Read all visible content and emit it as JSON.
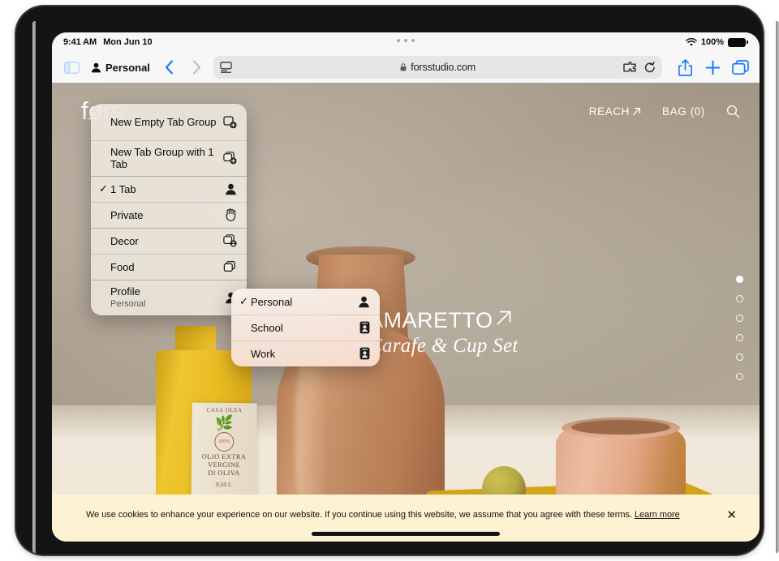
{
  "statusbar": {
    "time": "9:41 AM",
    "date": "Mon Jun 10",
    "wifi_icon": "wifi-icon",
    "battery_percent": "100%",
    "multitask_icon": "multitasking-dots-icon"
  },
  "toolbar": {
    "sidebar_icon": "sidebar-icon",
    "tab_group_label": "Personal",
    "tab_group_icon": "person-icon",
    "back_icon": "chevron-left-icon",
    "forward_icon": "chevron-right-icon",
    "reader_icon": "reader-view-icon",
    "url": "forsstudio.com",
    "lock_icon": "lock-icon",
    "extensions_icon": "extensions-puzzle-icon",
    "reload_icon": "reload-icon",
    "share_icon": "share-icon",
    "new_tab_icon": "plus-icon",
    "tabs_overview_icon": "tabs-overview-icon"
  },
  "tab_group_menu": {
    "items": [
      {
        "label": "New Empty Tab Group",
        "icon": "new-tab-group-icon",
        "checked": false,
        "sublabel": ""
      },
      {
        "label": "New Tab Group with 1 Tab",
        "icon": "new-tab-group-with-tab-icon",
        "checked": false,
        "sublabel": ""
      },
      {
        "label": "1 Tab",
        "icon": "person-icon",
        "checked": true,
        "sublabel": ""
      },
      {
        "label": "Private",
        "icon": "private-hand-icon",
        "checked": false,
        "sublabel": ""
      },
      {
        "label": "Decor",
        "icon": "tab-group-shared-icon",
        "checked": false,
        "sublabel": ""
      },
      {
        "label": "Food",
        "icon": "tab-group-icon",
        "checked": false,
        "sublabel": ""
      },
      {
        "label": "Profile",
        "icon": "person-icon",
        "checked": false,
        "sublabel": "Personal"
      }
    ]
  },
  "profile_submenu": {
    "items": [
      {
        "label": "Personal",
        "icon": "person-icon",
        "checked": true
      },
      {
        "label": "School",
        "icon": "contact-card-icon",
        "checked": false
      },
      {
        "label": "Work",
        "icon": "contact-card-icon",
        "checked": false
      }
    ]
  },
  "website": {
    "logo": "førs",
    "nav": [
      {
        "label": "REACH",
        "icon": "arrow-up-right-icon"
      },
      {
        "label": "BAG (0)",
        "icon": ""
      },
      {
        "label": "",
        "icon": "search-icon"
      }
    ],
    "hero_title": "AMARETTO",
    "hero_title_icon": "arrow-up-right-icon",
    "hero_subtitle": "Carafe & Cup Set",
    "pager_dots": 6,
    "pager_active_index": 0,
    "product_label": {
      "brand": "CASA OLEA",
      "line1": "OLIO EXTRA",
      "line2": "VERGINE",
      "line3": "DI OLIVA",
      "volume": "0,50 L",
      "stamp": "100%"
    }
  },
  "cookie_banner": {
    "text": "We use cookies to enhance your experience on our website. If you continue using this website, we assume that you agree with these terms.",
    "link_label": "Learn more",
    "close_icon": "close-x-icon"
  },
  "colors": {
    "accent_blue": "#1478ff",
    "banner_bg": "#fdf3d3",
    "menu_bg": "#f3eee4"
  }
}
